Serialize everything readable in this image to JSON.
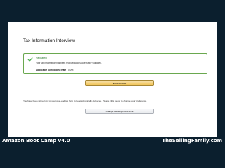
{
  "page": {
    "title": "Tax Information Interview"
  },
  "alert": {
    "icon": "checkmark-icon",
    "status_color": "#2e7d32",
    "heading": "Validated",
    "message": "Your tax information has been received and successfully validated.",
    "rate_label": "Applicable Withholding Rate :",
    "rate_value": "0.0%"
  },
  "actions": {
    "exit_label": "Exit Interview",
    "delivery_note": "You have been signed up for your year-end tax form to be electronically delivered. Please click below to change your preference.",
    "delivery_button_label": "Change Delivery Preference"
  },
  "captions": {
    "left": "Amazon Boot Camp v4.0",
    "right": "TheSellingFamily.com"
  }
}
